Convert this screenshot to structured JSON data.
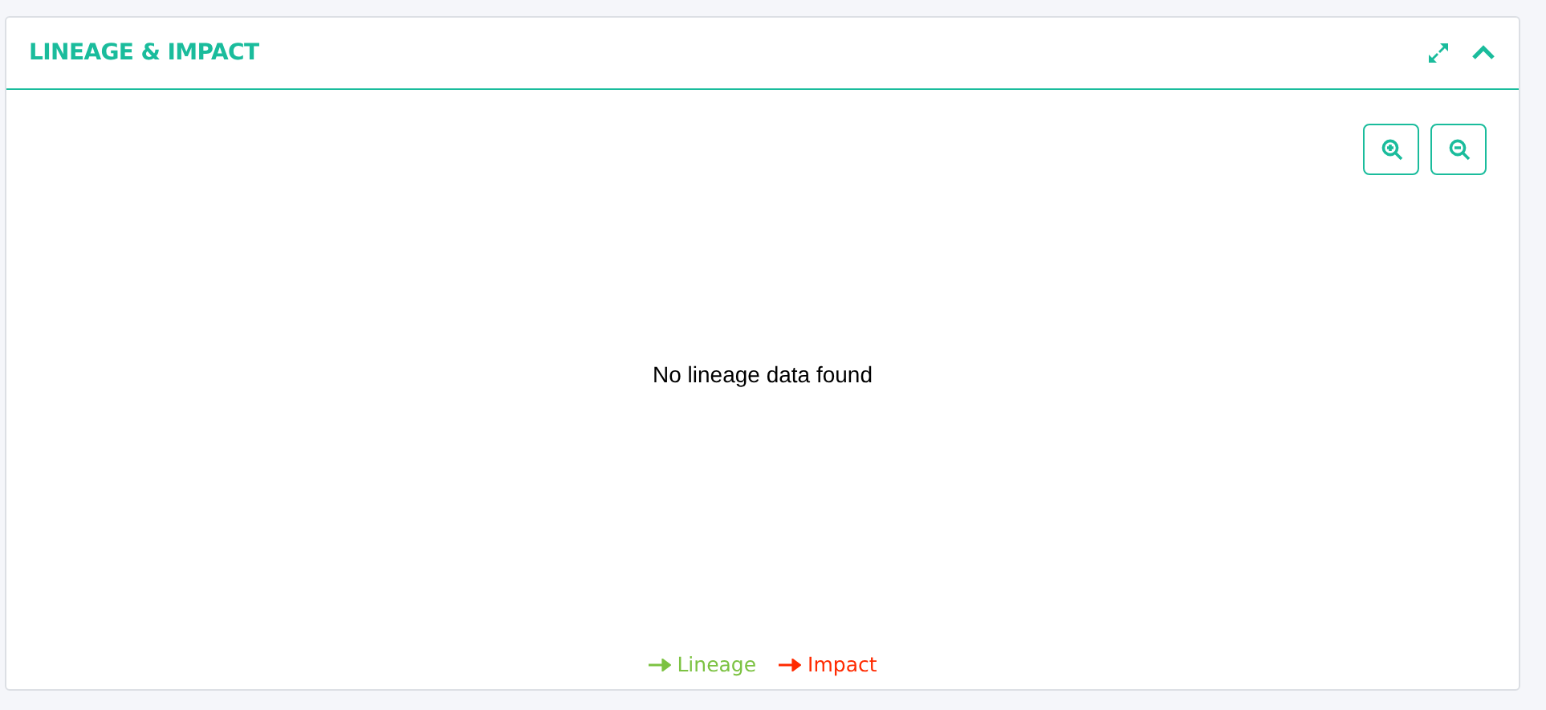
{
  "panel": {
    "title": "LINEAGE & IMPACT",
    "expanded": true
  },
  "message": "No lineage data found",
  "legend": [
    {
      "label": "Lineage",
      "color": "#7cc242"
    },
    {
      "label": "Impact",
      "color": "#ff2a00"
    }
  ]
}
